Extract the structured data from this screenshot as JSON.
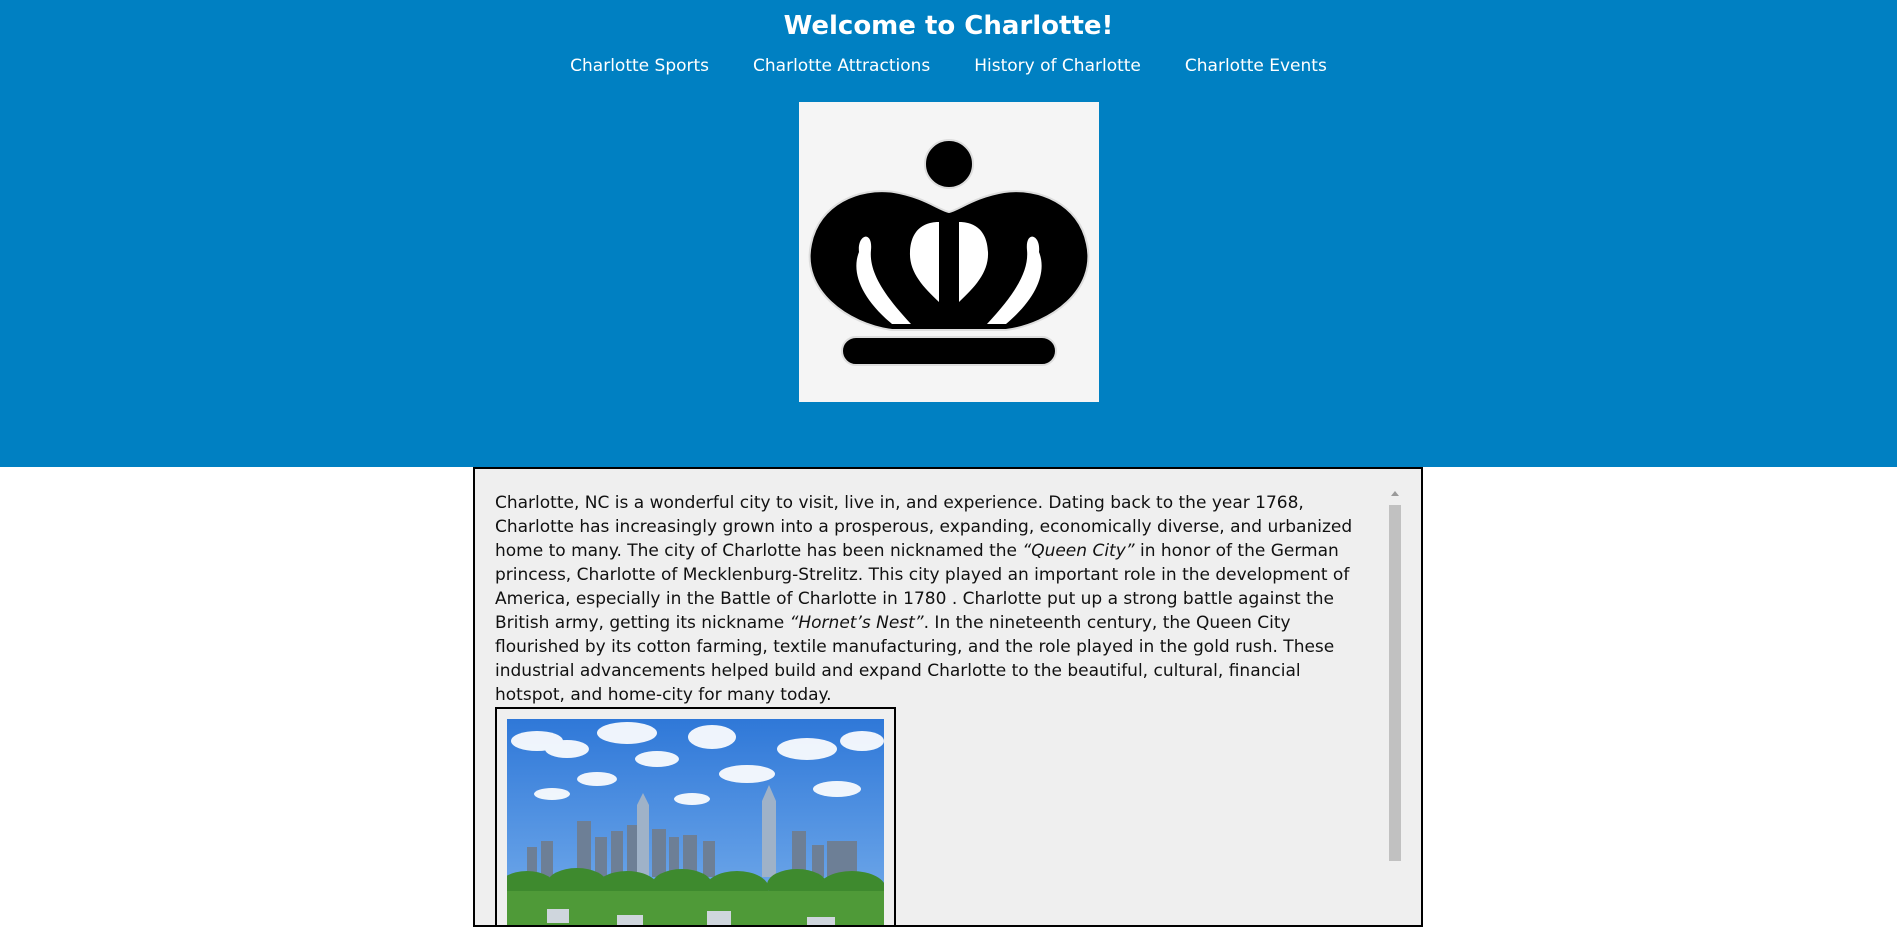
{
  "header": {
    "title": "Welcome to Charlotte!",
    "background_color": "#0080c2"
  },
  "nav": {
    "items": [
      {
        "label": "Charlotte Sports"
      },
      {
        "label": "Charlotte Attractions"
      },
      {
        "label": "History of Charlotte"
      },
      {
        "label": "Charlotte Events"
      }
    ]
  },
  "logo": {
    "icon": "crown-icon"
  },
  "article": {
    "part1": "Charlotte, NC is a wonderful city to visit, live in, and experience. Dating back to the year 1768, Charlotte has increasingly grown into a prosperous, expanding, economically diverse, and urbanized home to many. The city of Charlotte has been nicknamed the ",
    "nickname1": "“Queen City”",
    "part2": " in honor of the German princess, Charlotte of Mecklenburg-Strelitz. This city played an important role in the development of America, especially in the Battle of Charlotte in 1780 . Charlotte put up a strong battle against the British army, getting its nickname ",
    "nickname2": "“Hornet’s Nest”",
    "part3": ". In the nineteenth century, the Queen City flourished by its cotton farming, textile manufacturing, and the role played in the gold rush. These industrial advancements helped build and expand Charlotte to the beautiful, cultural, financial hotspot, and home-city for many today."
  },
  "photo": {
    "subject": "charlotte-skyline-photo"
  }
}
